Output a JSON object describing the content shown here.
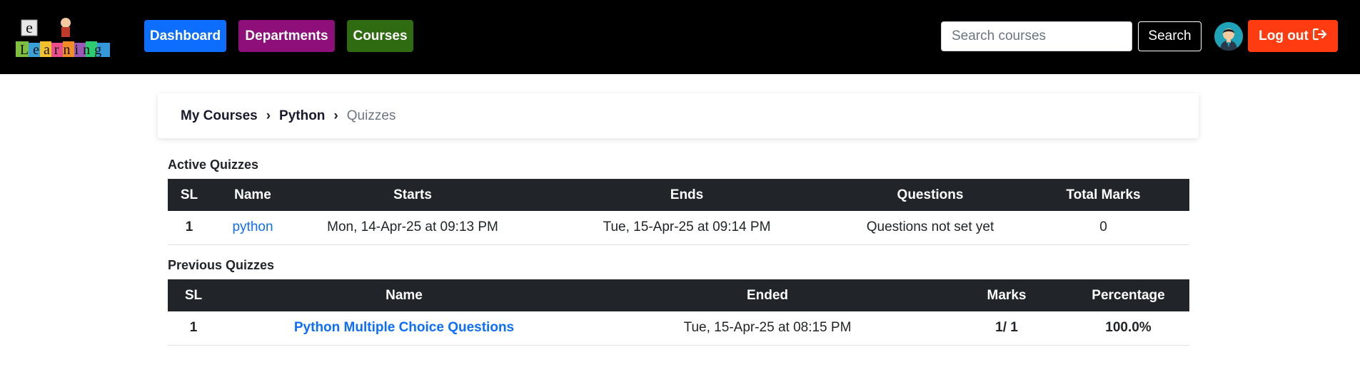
{
  "logo": {
    "letter_top": "e",
    "word": "Learning",
    "colors": [
      "#7fbf3f",
      "#3aa0d8",
      "#f2c12e",
      "#e94f8a",
      "#f28c28",
      "#9b59b6",
      "#2ecc71",
      "#3498db"
    ]
  },
  "nav": {
    "dashboard": {
      "label": "Dashboard",
      "color": "#0d6efd"
    },
    "departments": {
      "label": "Departments",
      "color": "#8e0f7a"
    },
    "courses": {
      "label": "Courses",
      "color": "#2f6b10"
    }
  },
  "search": {
    "placeholder": "Search courses",
    "value": "",
    "button_label": "Search"
  },
  "user": {
    "avatar_icon": "user-avatar-icon",
    "logout_label": "Log out",
    "logout_icon": "sign-out-icon",
    "logout_color": "#ff3b12"
  },
  "breadcrumb": {
    "items": [
      "My Courses",
      "Python"
    ],
    "current": "Quizzes",
    "separator": "›"
  },
  "active_quizzes": {
    "title": "Active Quizzes",
    "columns": [
      "SL",
      "Name",
      "Starts",
      "Ends",
      "Questions",
      "Total Marks"
    ],
    "rows": [
      {
        "sl": "1",
        "name": "python",
        "starts": "Mon, 14-Apr-25 at 09:13 PM",
        "ends": "Tue, 15-Apr-25 at 09:14 PM",
        "questions": "Questions not set yet",
        "total_marks": "0"
      }
    ]
  },
  "previous_quizzes": {
    "title": "Previous Quizzes",
    "columns": [
      "SL",
      "Name",
      "Ended",
      "Marks",
      "Percentage"
    ],
    "rows": [
      {
        "sl": "1",
        "name": "Python Multiple Choice Questions",
        "ended": "Tue, 15-Apr-25 at 08:15 PM",
        "marks": "1/ 1",
        "percentage": "100.0%"
      }
    ]
  }
}
